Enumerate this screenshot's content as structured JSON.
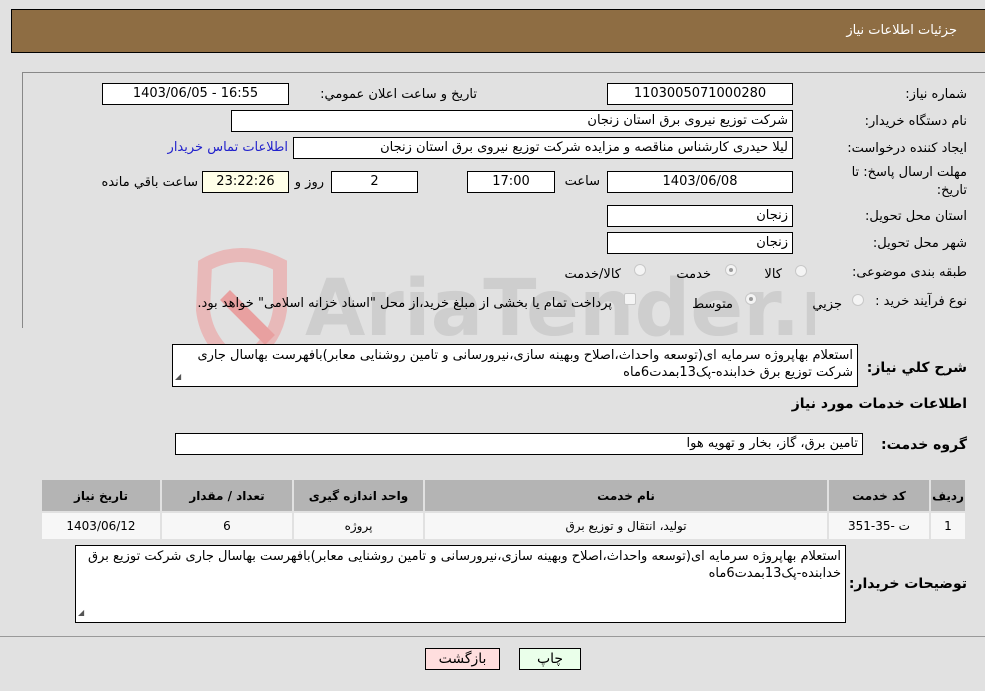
{
  "header": {
    "title": "جزئیات اطلاعات نیاز"
  },
  "fields": {
    "need_number": {
      "label": "شماره نیاز:",
      "value": "1103005071000280"
    },
    "announce": {
      "label": "تاریخ و ساعت اعلان عمومي:",
      "value": "1403/06/05 - 16:55"
    },
    "buyer_org": {
      "label": "نام دستگاه خریدار:",
      "value": "شرکت توزیع نیروی برق استان زنجان"
    },
    "creator": {
      "label": "ایجاد کننده درخواست:",
      "value": "لیلا حیدری کارشناس مناقصه و مزایده شرکت توزیع نیروی برق استان زنجان",
      "contact_link": "اطلاعات تماس خریدار"
    },
    "deadline": {
      "label": "مهلت ارسال پاسخ: تا تاریخ:",
      "date": "1403/06/08",
      "time_label": "ساعت",
      "time": "17:00",
      "days": "2",
      "days_label": "روز و",
      "remaining": "23:22:26",
      "remaining_label": "ساعت باقي مانده"
    },
    "province": {
      "label": "استان محل تحویل:",
      "value": "زنجان"
    },
    "city": {
      "label": "شهر محل تحویل:",
      "value": "زنجان"
    },
    "category": {
      "label": "طبقه بندی موضوعی:",
      "options": [
        "کالا",
        "خدمت",
        "کالا/خدمت"
      ],
      "selected": "خدمت"
    },
    "process": {
      "label": "نوع فرآیند خرید :",
      "options": [
        "جزيي",
        "متوسط"
      ],
      "selected": "متوسط",
      "treasury_note": "پرداخت تمام یا بخشی از مبلغ خرید،از محل \"اسناد خزانه اسلامی\" خواهد بود."
    }
  },
  "description": {
    "label": "شرح کلي نياز:",
    "value": "استعلام بهاپروژه سرمایه ای(توسعه واحداث،اصلاح وبهینه سازی،نیرورسانی و تامین روشنایی معابر)بافهرست بهاسال جاری شرکت توزیع برق خدابنده-پک13بمدت6ماه"
  },
  "services_section": {
    "title": "اطلاعات خدمات مورد نياز",
    "group_label": "گروه خدمت:",
    "group_value": "تامین برق، گاز، بخار و تهویه هوا"
  },
  "table": {
    "headers": [
      "ردیف",
      "کد خدمت",
      "نام خدمت",
      "واحد اندازه گیری",
      "تعداد / مقدار",
      "تاریخ نیاز"
    ],
    "rows": [
      [
        "1",
        "ت -35-351",
        "تولید، انتقال و توزیع برق",
        "پروژه",
        "6",
        "1403/06/12"
      ]
    ]
  },
  "buyer_notes": {
    "label": "توضیحات خریدار:",
    "value": "استعلام بهاپروژه سرمایه ای(توسعه واحداث،اصلاح وبهینه سازی،نیرورسانی و تامین روشنایی معابر)بافهرست بهاسال جاری شرکت توزیع برق خدابنده-پک13بمدت6ماه"
  },
  "buttons": {
    "print": "چاپ",
    "back": "بازگشت"
  },
  "watermark": {
    "text": "AriaTender.neT"
  }
}
